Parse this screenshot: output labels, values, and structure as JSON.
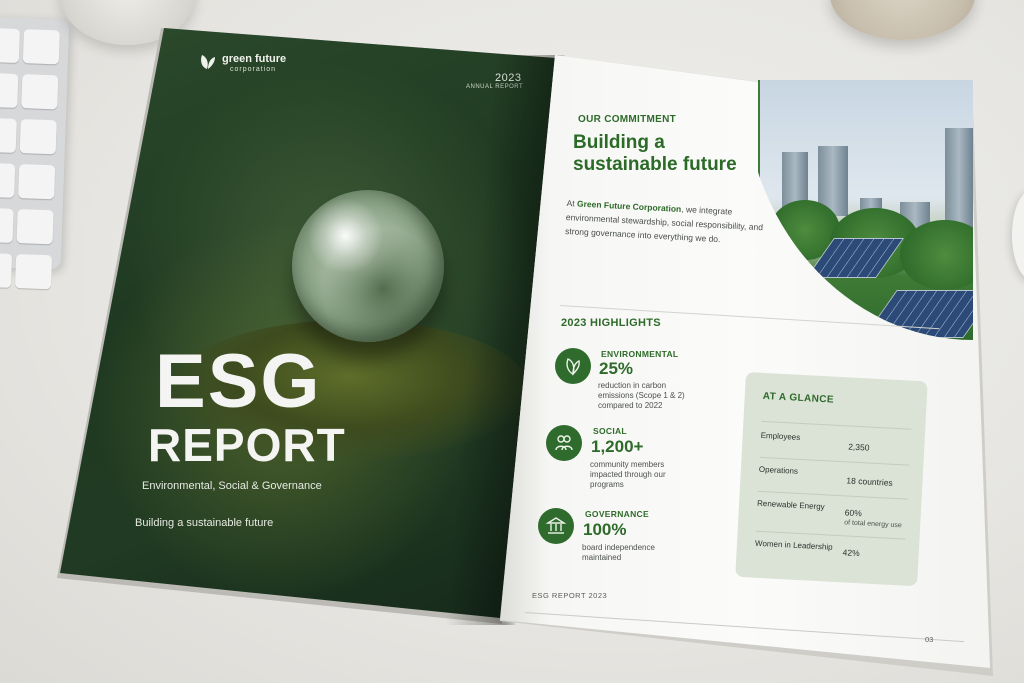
{
  "cover": {
    "brand_name": "green future",
    "brand_sub": "corporation",
    "year": "2023",
    "annual_report": "ANNUAL REPORT",
    "title_line1": "ESG",
    "title_line2": "REPORT",
    "subtitle": "Environmental, Social & Governance",
    "tagline": "Building a sustainable future"
  },
  "commitment": {
    "label": "OUR COMMITMENT",
    "heading": "Building a sustainable future",
    "body_prefix": "At ",
    "body_brand": "Green Future Corporation",
    "body_suffix": ", we integrate environmental stewardship, social responsibility, and strong governance into everything we do."
  },
  "highlights": {
    "title": "2023 HIGHLIGHTS",
    "items": [
      {
        "category": "ENVIRONMENTAL",
        "value": "25%",
        "desc": "reduction in carbon emissions (Scope 1 & 2) compared to 2022",
        "icon": "leaf-icon"
      },
      {
        "category": "SOCIAL",
        "value": "1,200+",
        "desc": "community members impacted through our programs",
        "icon": "people-icon"
      },
      {
        "category": "GOVERNANCE",
        "value": "100%",
        "desc": "board independence maintained",
        "icon": "building-icon"
      }
    ]
  },
  "glance": {
    "title": "AT A GLANCE",
    "rows": [
      {
        "label": "Employees",
        "value": "2,350",
        "note": ""
      },
      {
        "label": "Operations",
        "value": "18 countries",
        "note": ""
      },
      {
        "label": "Renewable Energy",
        "value": "60%",
        "note": "of total energy use"
      },
      {
        "label": "Women in Leadership",
        "value": "42%",
        "note": ""
      }
    ]
  },
  "footer": {
    "text": "ESG REPORT 2023",
    "page": "03"
  },
  "colors": {
    "brand_green": "#2e6b2a",
    "cover_dark": "#1f3a22",
    "glance_bg": "#dbe2d6"
  }
}
